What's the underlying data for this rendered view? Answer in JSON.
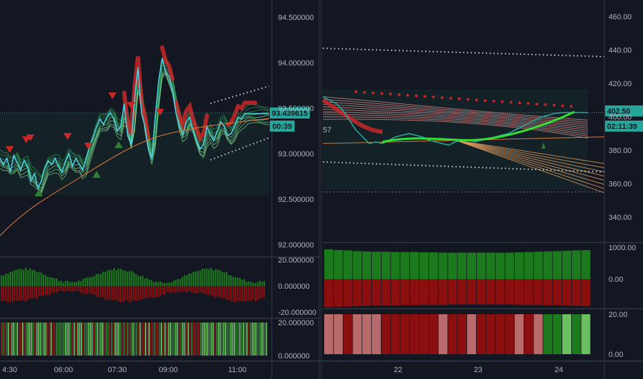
{
  "colors": {
    "background": "#131722",
    "separator": "#2a2e39",
    "axis_text": "#b2b5be",
    "price_tag": "#26a69a",
    "up": "#1b7a1b",
    "down": "#8b0f0f",
    "ribbon_green": "#66bb6a",
    "ribbon_red": "#c62828",
    "ema": "#e07a3a",
    "dots": "#d1d4dc"
  },
  "chart_data": [
    {
      "type": "line",
      "name": "left-price",
      "x_ticks": [
        "4:30",
        "06:00",
        "07:30",
        "09:00",
        "11:00"
      ],
      "y_ticks": [
        "94.500000",
        "94.000000",
        "93.500000",
        "93.000000",
        "92.500000",
        "92.000000"
      ],
      "ylim": [
        92.0,
        94.5
      ],
      "x": [
        0,
        5,
        10,
        15,
        20,
        25,
        30,
        35,
        40,
        45,
        50,
        55,
        60,
        65,
        70,
        75,
        80,
        85,
        90,
        95,
        100,
        105,
        110,
        115,
        120,
        125,
        130,
        135,
        140,
        145,
        150,
        155,
        160,
        165,
        170,
        175,
        180,
        185,
        190,
        195,
        200,
        205,
        210,
        215,
        220,
        225,
        230,
        235,
        240,
        245,
        250,
        255,
        260,
        265,
        270,
        275,
        280,
        285,
        290,
        295,
        300,
        305,
        310,
        315,
        320,
        325,
        330,
        335,
        340,
        345,
        350,
        355,
        360,
        365,
        370,
        375,
        380,
        385,
        390
      ],
      "values": [
        92.95,
        92.88,
        92.95,
        92.8,
        92.98,
        92.9,
        92.82,
        92.93,
        92.85,
        92.7,
        92.78,
        92.62,
        92.7,
        92.85,
        92.92,
        92.88,
        92.95,
        92.85,
        92.8,
        92.92,
        93.0,
        92.86,
        92.95,
        92.88,
        92.82,
        92.95,
        93.08,
        93.18,
        93.3,
        93.38,
        93.32,
        93.4,
        93.45,
        93.38,
        93.25,
        93.3,
        93.55,
        93.2,
        93.1,
        93.6,
        93.95,
        93.45,
        93.3,
        93.05,
        92.95,
        93.4,
        93.8,
        94.05,
        93.9,
        93.85,
        93.7,
        93.45,
        93.3,
        93.2,
        93.35,
        93.4,
        93.25,
        93.15,
        93.05,
        93.1,
        93.3,
        93.2,
        93.15,
        93.25,
        93.35,
        93.3,
        93.2,
        93.22,
        93.3,
        93.4,
        93.38,
        93.44,
        93.44,
        93.44,
        93.44,
        93.44,
        93.44,
        93.44,
        93.44
      ],
      "last_price_label": "93.439615",
      "countdown_label": "00:39"
    },
    {
      "type": "bar",
      "name": "left-oscillator",
      "y_ticks": [
        "20.000000",
        "0.000000",
        "-20.000000"
      ],
      "ylim": [
        -20,
        20
      ],
      "bars": 120
    },
    {
      "type": "bar",
      "name": "left-volume",
      "y_ticks": [
        "20.000000",
        "0.000000"
      ],
      "ylim": [
        0,
        20
      ],
      "bars": 150
    },
    {
      "type": "line",
      "name": "right-price",
      "x_ticks": [
        "22",
        "23",
        "24"
      ],
      "y_ticks": [
        "460.00",
        "440.00",
        "420.00",
        "400.00",
        "380.00",
        "360.00",
        "340.00"
      ],
      "ylim": [
        330,
        465
      ],
      "x": [
        0,
        1,
        2,
        3,
        4,
        5,
        6,
        7,
        8,
        9,
        10,
        11,
        12,
        13,
        14,
        15,
        16,
        17,
        18,
        19,
        20,
        21,
        22,
        23,
        24,
        25,
        26,
        27,
        28,
        29,
        30,
        31,
        32,
        33,
        34,
        35,
        36,
        37,
        38,
        39,
        40
      ],
      "values": [
        412,
        410,
        408,
        404,
        398,
        392,
        388,
        384,
        385,
        384,
        386,
        388,
        389,
        390,
        389,
        388,
        386,
        385,
        384,
        383,
        385,
        386,
        386,
        385,
        386,
        387,
        388,
        389,
        390,
        392,
        394,
        396,
        398,
        400,
        401,
        402,
        402.5,
        402.5,
        402.5,
        402.5,
        402.5
      ],
      "last_price_label": "402.50",
      "countdown_label": "02:11:39",
      "side_label": "57"
    },
    {
      "type": "bar",
      "name": "right-flow",
      "y_ticks": [
        "1000.00",
        "0.00"
      ],
      "ylim": [
        -1200,
        1200
      ],
      "pos": [
        930,
        910,
        900,
        880,
        870,
        860,
        860,
        850,
        850,
        850,
        840,
        840,
        830,
        830,
        830,
        830,
        830,
        830,
        830,
        830,
        840,
        850,
        860,
        870,
        880,
        890,
        900,
        910
      ],
      "neg": [
        -880,
        -870,
        -860,
        -850,
        -840,
        -830,
        -830,
        -830,
        -820,
        -820,
        -810,
        -810,
        -810,
        -800,
        -800,
        -800,
        -800,
        -800,
        -800,
        -800,
        -810,
        -810,
        -810,
        -820,
        -820,
        -830,
        -840,
        -850
      ]
    },
    {
      "type": "bar",
      "name": "right-strength",
      "y_ticks": [
        "20.00",
        "0.00"
      ],
      "ylim": [
        0,
        20
      ]
    }
  ]
}
